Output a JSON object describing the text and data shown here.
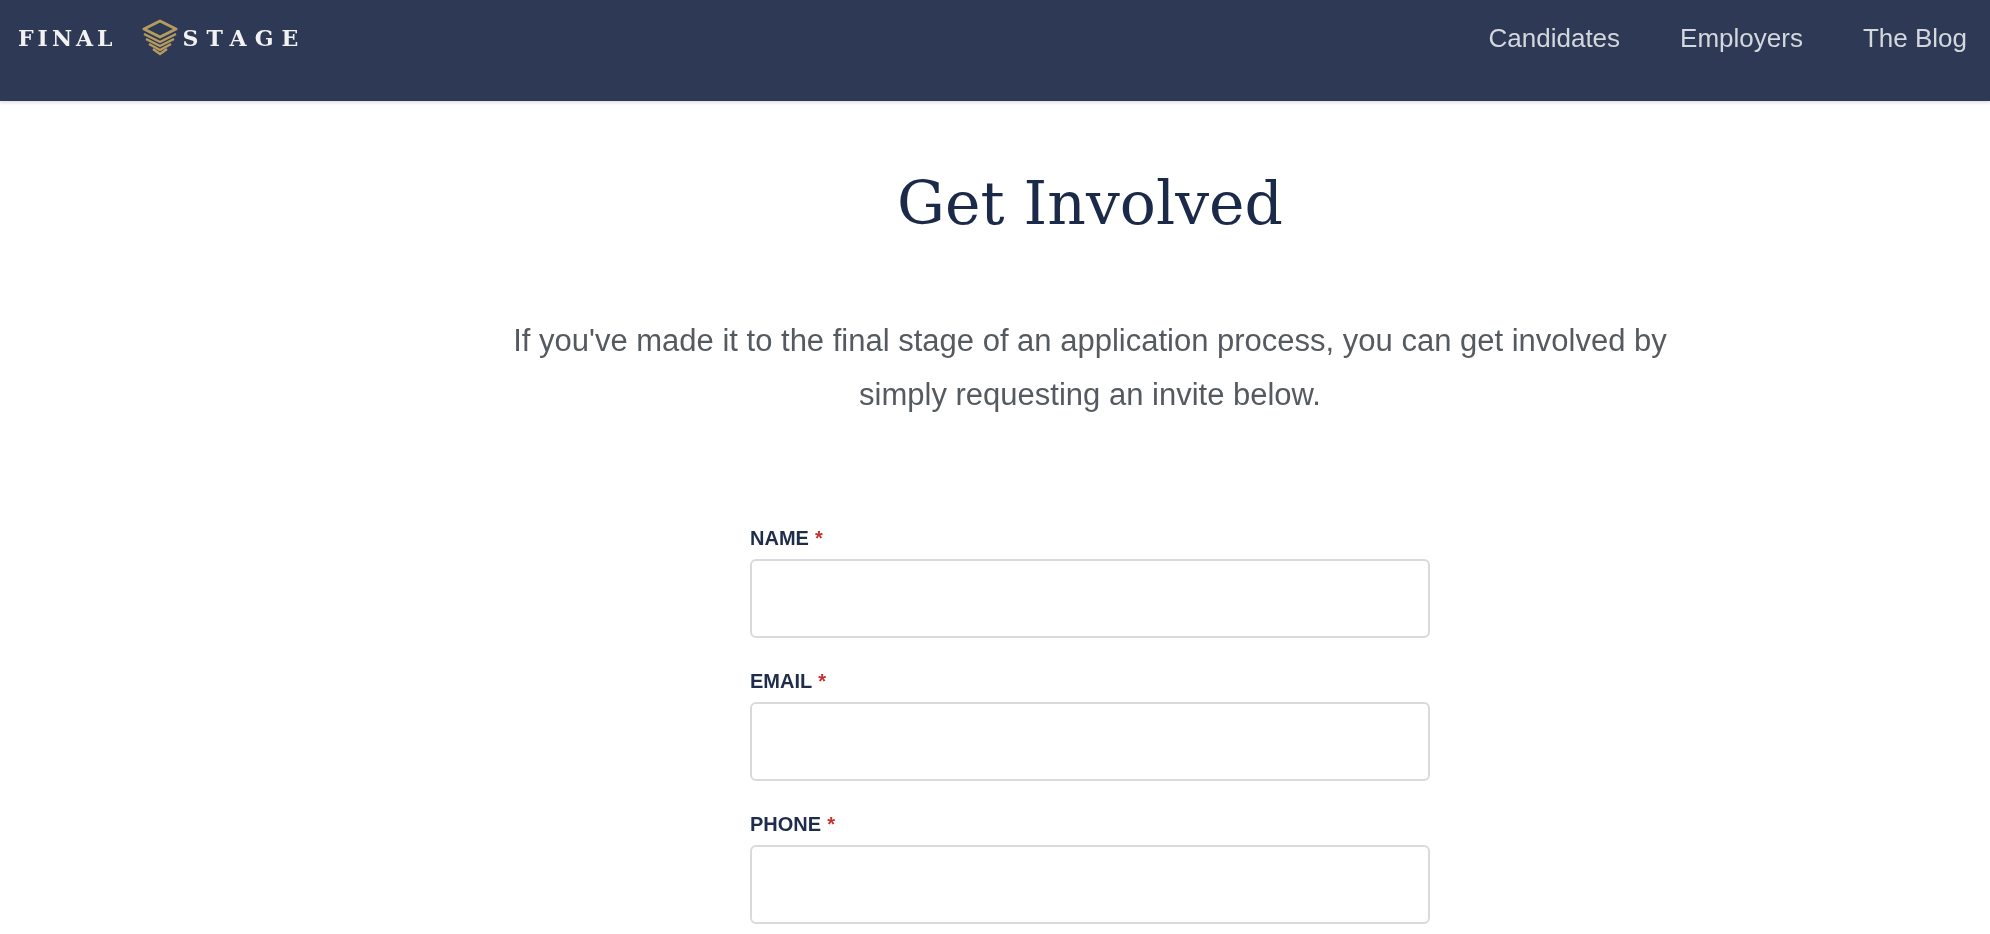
{
  "header": {
    "logo": {
      "word_1": "FINAL",
      "word_2": "STAGE"
    },
    "nav": [
      {
        "label": "Candidates"
      },
      {
        "label": "Employers"
      },
      {
        "label": "The Blog"
      }
    ]
  },
  "main": {
    "title": "Get Involved",
    "intro": "If you've made it to the final stage of an application process, you can get involved by simply requesting an invite below.",
    "form": {
      "fields": [
        {
          "label": "NAME",
          "required_mark": "*"
        },
        {
          "label": "EMAIL",
          "required_mark": "*"
        },
        {
          "label": "PHONE",
          "required_mark": "*"
        }
      ]
    }
  }
}
